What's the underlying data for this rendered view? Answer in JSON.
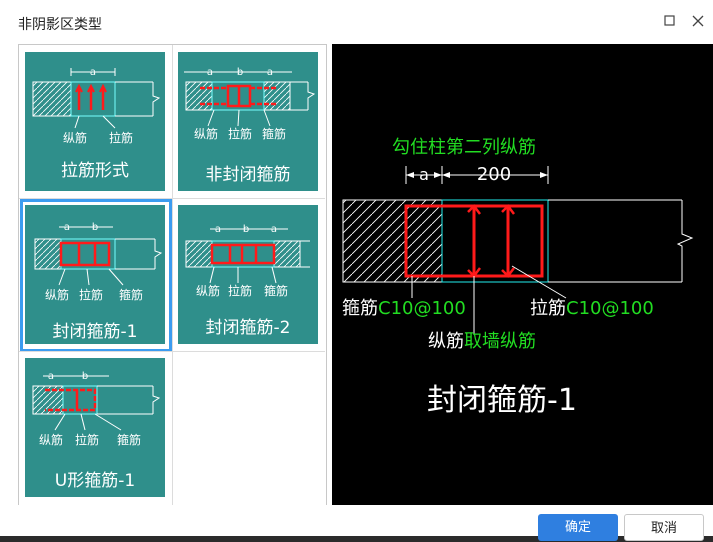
{
  "dialog": {
    "title": "非阴影区类型",
    "buttons": {
      "ok": "确定",
      "cancel": "取消"
    }
  },
  "options": [
    {
      "id": "tie",
      "label": "拉筋形式",
      "dims": [
        "a"
      ],
      "callouts": [
        "纵筋",
        "拉筋"
      ]
    },
    {
      "id": "open-stirrup",
      "label": "非封闭箍筋",
      "dims": [
        "a",
        "b",
        "a"
      ],
      "callouts": [
        "纵筋",
        "拉筋",
        "箍筋"
      ]
    },
    {
      "id": "closed-stirrup-1",
      "label": "封闭箍筋-1",
      "dims": [
        "a",
        "b"
      ],
      "callouts": [
        "纵筋",
        "拉筋",
        "箍筋"
      ],
      "selected": true
    },
    {
      "id": "closed-stirrup-2",
      "label": "封闭箍筋-2",
      "dims": [
        "a",
        "b",
        "a"
      ],
      "callouts": [
        "纵筋",
        "拉筋",
        "箍筋"
      ]
    },
    {
      "id": "u-stirrup-1",
      "label": "U形箍筋-1",
      "dims": [
        "a",
        "b"
      ],
      "callouts": [
        "纵筋",
        "拉筋",
        "箍筋"
      ]
    }
  ],
  "preview": {
    "top_note": "勾住柱第二列纵筋",
    "dim_a": "a",
    "dim_b": "200",
    "stirrup_label": "箍筋",
    "stirrup_spec": "C10@100",
    "tie_label": "拉筋",
    "tie_spec": "C10@100",
    "long_label": "纵筋",
    "long_spec": "取墙纵筋",
    "caption": "封闭箍筋-1"
  },
  "colors": {
    "card": "#2f8f8b",
    "selected_border": "#3c9cf0",
    "rebar": "#ff1a1a",
    "cad_green": "#22dd22",
    "ok_button": "#2f7fe0"
  }
}
